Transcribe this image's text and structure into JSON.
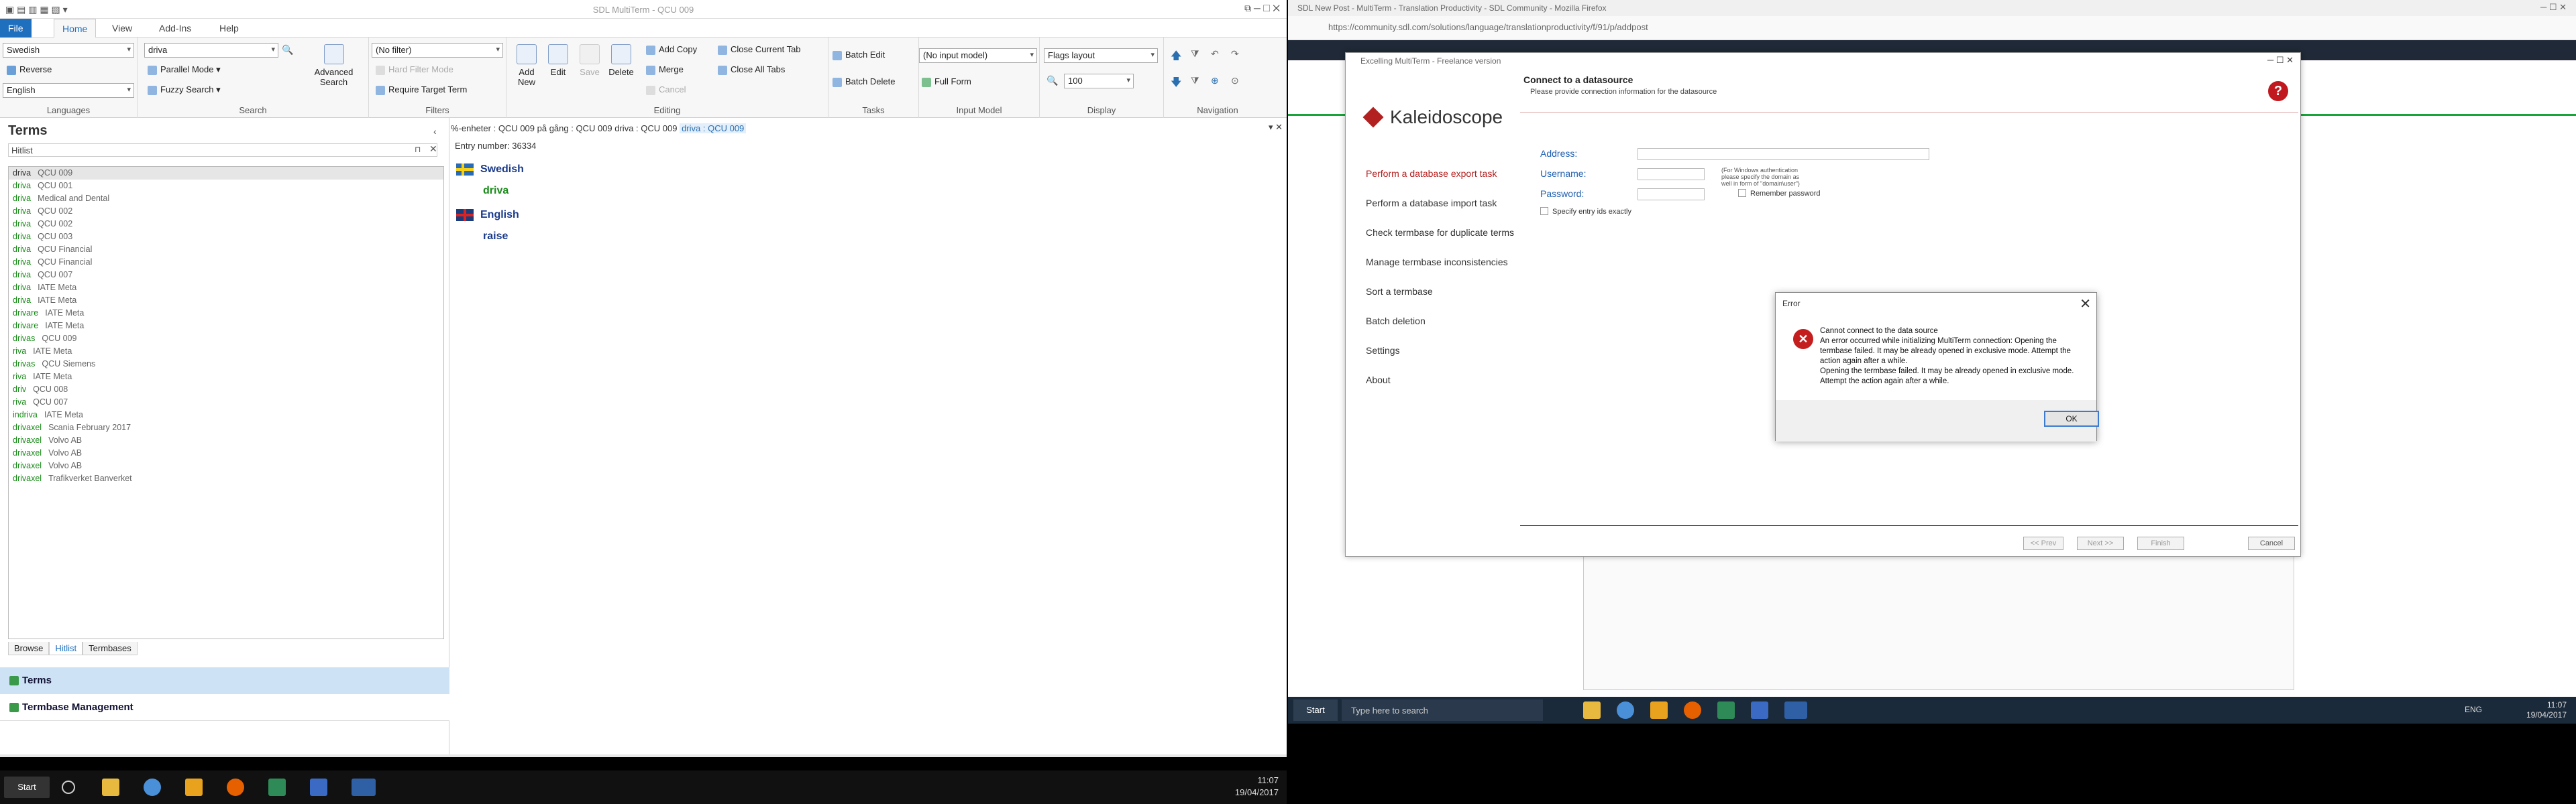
{
  "multiterm": {
    "title": "SDL MultiTerm - QCU 009",
    "menu": [
      "File",
      "Home",
      "View",
      "Add-Ins",
      "Help"
    ],
    "ribbon": {
      "languages": {
        "source": "Swedish",
        "target": "English",
        "reverse": "Reverse",
        "label": "Languages"
      },
      "search": {
        "query": "driva",
        "parallel": "Parallel Mode",
        "fuzzy": "Fuzzy Search",
        "advanced": "Advanced Search",
        "label": "Search"
      },
      "filters": {
        "filter": "(No filter)",
        "hard": "Hard Filter Mode",
        "require": "Require Target Term",
        "label": "Filters"
      },
      "editing": {
        "add_new": "Add New",
        "edit": "Edit",
        "save": "Save",
        "delete": "Delete",
        "add_copy": "Add Copy",
        "merge": "Merge",
        "cancel": "Cancel",
        "close_current": "Close Current Tab",
        "close_all": "Close All Tabs",
        "label": "Editing"
      },
      "tasks": {
        "batch_edit": "Batch Edit",
        "batch_delete": "Batch Delete",
        "label": "Tasks"
      },
      "input_model": {
        "model": "(No input model)",
        "full_form": "Full Form",
        "label": "Input Model"
      },
      "display": {
        "layout": "Flags layout",
        "zoom": "100",
        "label": "Display"
      },
      "navigation": {
        "label": "Navigation"
      }
    },
    "terms_panel": {
      "title": "Terms",
      "hitlist_label": "Hitlist",
      "rows": [
        {
          "term": "driva",
          "db": "QCU 009"
        },
        {
          "term": "driva",
          "db": "QCU 001"
        },
        {
          "term": "driva",
          "db": "Medical and Dental"
        },
        {
          "term": "driva",
          "db": "QCU 002"
        },
        {
          "term": "driva",
          "db": "QCU 002"
        },
        {
          "term": "driva",
          "db": "QCU 003"
        },
        {
          "term": "driva",
          "db": "QCU Financial"
        },
        {
          "term": "driva",
          "db": "QCU Financial"
        },
        {
          "term": "driva",
          "db": "QCU 007"
        },
        {
          "term": "driva",
          "db": "IATE Meta"
        },
        {
          "term": "driva",
          "db": "IATE Meta"
        },
        {
          "term": "drivare",
          "db": "IATE Meta"
        },
        {
          "term": "drivare",
          "db": "IATE Meta"
        },
        {
          "term": "drivas",
          "db": "QCU 009"
        },
        {
          "term": "riva",
          "db": "IATE Meta"
        },
        {
          "term": "drivas",
          "db": "QCU Siemens"
        },
        {
          "term": "riva",
          "db": "IATE Meta"
        },
        {
          "term": "driv",
          "db": "QCU 008"
        },
        {
          "term": "riva",
          "db": "QCU 007"
        },
        {
          "term": "indriva",
          "db": "IATE Meta"
        },
        {
          "term": "drivaxel",
          "db": "Scania February 2017"
        },
        {
          "term": "drivaxel",
          "db": "Volvo AB"
        },
        {
          "term": "drivaxel",
          "db": "Volvo AB"
        },
        {
          "term": "drivaxel",
          "db": "Volvo AB"
        },
        {
          "term": "drivaxel",
          "db": "Trafikverket Banverket"
        }
      ],
      "tabs": [
        "Browse",
        "Hitlist",
        "Termbases"
      ],
      "nav": [
        "Terms",
        "Termbase Management"
      ]
    },
    "entry": {
      "breadcrumb": "%-enheter : QCU 009   på gång : QCU 009   driva : QCU 009",
      "breadcrumb_active": "driva : QCU 009",
      "entry_number": "Entry number:   36334",
      "source_lang": "Swedish",
      "source_term": "driva",
      "target_lang": "English",
      "target_term": "raise"
    },
    "taskbar": {
      "start": "Start",
      "time": "11:07",
      "date": "19/04/2017"
    }
  },
  "firefox": {
    "title": "SDL New Post - MultiTerm - Translation Productivity - SDL Community - Mozilla Firefox",
    "url": "https://community.sdl.com/solutions/language/translationproductivity/f/91/p/addpost"
  },
  "wizard": {
    "title": "Excelling MultiTerm - Freelance version",
    "brand": "Kaleidoscope",
    "heading": "Connect to a datasource",
    "subheading": "Please provide connection information for the datasource",
    "nav": [
      "Perform a database export task",
      "Perform a database import task",
      "Check termbase for duplicate terms",
      "Manage termbase inconsistencies",
      "Sort a termbase",
      "Batch deletion",
      "Settings",
      "About"
    ],
    "fields": {
      "address": "Address:",
      "username": "Username:",
      "password": "Password:"
    },
    "note": "(For Windows authentication please specify the domain as well in form of \"domain\\user\")",
    "remember": "Remember password",
    "specify": "Specify entry ids exactly",
    "buttons": {
      "prev": "<< Prev",
      "next": "Next >>",
      "finish": "Finish",
      "cancel": "Cancel"
    }
  },
  "error_dialog": {
    "title": "Error",
    "line1": "Cannot connect to the data source",
    "line2": "An error occurred while initializing MultiTerm connection: Opening the termbase failed. It may be already opened in exclusive mode. Attempt the action again after a while.",
    "line3": "Opening the termbase failed. It may be already opened in exclusive mode. Attempt the action again after a while.",
    "ok": "OK"
  },
  "right_taskbar": {
    "start": "Start",
    "search": "Type here to search",
    "lang": "ENG",
    "time": "11:07",
    "date": "19/04/2017"
  },
  "colors": {
    "accent": "#1f6fbf",
    "term_green": "#1a8a1a",
    "error_red": "#c41e1e",
    "brand_red": "#b32020"
  }
}
